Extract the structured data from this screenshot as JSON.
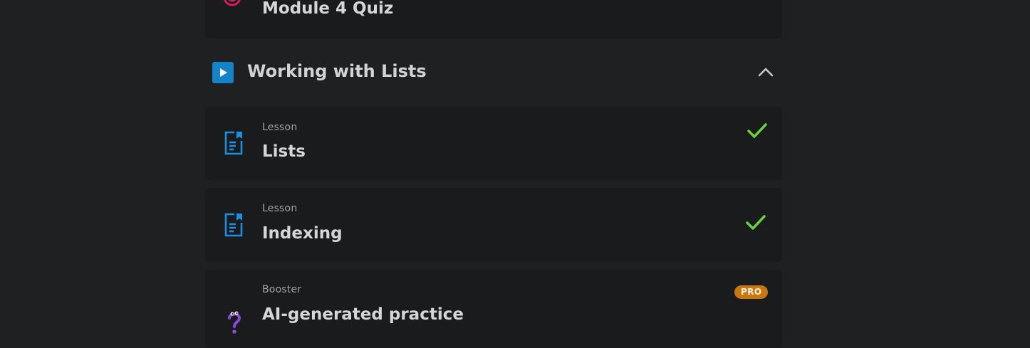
{
  "quiz_card": {
    "title": "Module 4 Quiz",
    "icon": "target-icon"
  },
  "section": {
    "title": "Working with Lists",
    "icon": "play-icon",
    "toggle_icon": "chevron-up-icon",
    "expanded": true
  },
  "items": [
    {
      "kind": "Lesson",
      "title": "Lists",
      "icon": "document-icon",
      "status": "completed"
    },
    {
      "kind": "Lesson",
      "title": "Indexing",
      "icon": "document-icon",
      "status": "completed"
    },
    {
      "kind": "Booster",
      "title": "AI-generated practice",
      "icon": "question-mark-icon",
      "badge": "PRO"
    }
  ],
  "colors": {
    "page_background": "#1f2022",
    "card_background": "#1a1b1d",
    "accent_blue": "#1583c7",
    "check_green": "#6bd13e",
    "pro_badge": "#c7780e",
    "quiz_red": "#d61c5a",
    "booster_purple": "#8a4ad6"
  }
}
